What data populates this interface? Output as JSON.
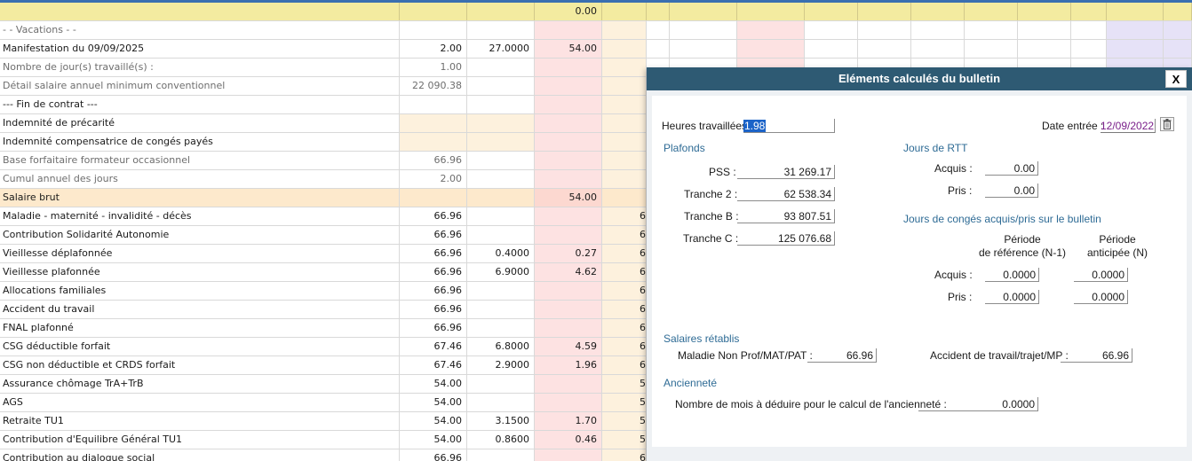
{
  "grid": {
    "header_value": "0.00",
    "rows": [
      {
        "label": "- - Vacations - -",
        "style": "grey"
      },
      {
        "label": "Manifestation du 09/09/2025",
        "base": "2.00",
        "taux": "27.0000",
        "gain": "54.00"
      },
      {
        "label": "Nombre de jour(s) travaillé(s) :",
        "base": "1.00",
        "style": "grey"
      },
      {
        "label": "Détail salaire annuel minimum conventionnel",
        "base": "22 090.38",
        "style": "grey"
      },
      {
        "label": "--- Fin de contrat ---"
      },
      {
        "label": "Indemnité de précarité",
        "tint": "brut"
      },
      {
        "label": "Indemnité compensatrice de congés payés",
        "tint": "brut"
      },
      {
        "label": "Base forfaitaire formateur occasionnel",
        "base": "66.96",
        "style": "grey"
      },
      {
        "label": "Cumul annuel des jours",
        "base": "2.00",
        "style": "grey"
      },
      {
        "label": "Salaire brut",
        "gain": "54.00",
        "style": "brut"
      },
      {
        "label": "Maladie - maternité - invalidité - décès",
        "base": "66.96",
        "trunc": "6"
      },
      {
        "label": "Contribution Solidarité Autonomie",
        "base": "66.96",
        "trunc": "6"
      },
      {
        "label": "Vieillesse déplafonnée",
        "base": "66.96",
        "taux": "0.4000",
        "gain": "0.27",
        "trunc": "6"
      },
      {
        "label": "Vieillesse plafonnée",
        "base": "66.96",
        "taux": "6.9000",
        "gain": "4.62",
        "trunc": "6"
      },
      {
        "label": "Allocations familiales",
        "base": "66.96",
        "trunc": "6"
      },
      {
        "label": "Accident du travail",
        "base": "66.96",
        "trunc": "6"
      },
      {
        "label": "FNAL plafonné",
        "base": "66.96",
        "trunc": "6"
      },
      {
        "label": "CSG déductible forfait",
        "base": "67.46",
        "taux": "6.8000",
        "gain": "4.59",
        "trunc": "6"
      },
      {
        "label": "CSG non déductible et CRDS forfait",
        "base": "67.46",
        "taux": "2.9000",
        "gain": "1.96",
        "trunc": "6"
      },
      {
        "label": "Assurance chômage TrA+TrB",
        "base": "54.00",
        "trunc": "5"
      },
      {
        "label": "AGS",
        "base": "54.00",
        "trunc": "5"
      },
      {
        "label": "Retraite TU1",
        "base": "54.00",
        "taux": "3.1500",
        "gain": "1.70",
        "trunc": "5"
      },
      {
        "label": "Contribution d'Equilibre Général TU1",
        "base": "54.00",
        "taux": "0.8600",
        "gain": "0.46",
        "trunc": "5"
      },
      {
        "label": "Contribution au dialogue social",
        "base": "66.96",
        "trunc": "6"
      }
    ]
  },
  "dialog": {
    "title": "Eléments calculés du bulletin",
    "close_label": "X",
    "heures_label": "Heures travaillées :",
    "heures_value": "1.98",
    "date_entree_label": "Date entrée :",
    "date_entree_value": "12/09/2022",
    "plafonds_title": "Plafonds",
    "pss_label": "PSS :",
    "pss_value": "31 269.17",
    "tranche2_label": "Tranche 2 :",
    "tranche2_value": "62 538.34",
    "trancheB_label": "Tranche B :",
    "trancheB_value": "93 807.51",
    "trancheC_label": "Tranche C :",
    "trancheC_value": "125 076.68",
    "rtt_title": "Jours de RTT",
    "rtt_acquis_label": "Acquis :",
    "rtt_acquis_value": "0.00",
    "rtt_pris_label": "Pris :",
    "rtt_pris_value": "0.00",
    "conges_title": "Jours de congés acquis/pris sur le bulletin",
    "col_ref_line1": "Période",
    "col_ref_line2": "de référence (N-1)",
    "col_ant_line1": "Période",
    "col_ant_line2": "anticipée (N)",
    "conges_acquis_label": "Acquis :",
    "conges_acquis_ref": "0.0000",
    "conges_acquis_ant": "0.0000",
    "conges_pris_label": "Pris :",
    "conges_pris_ref": "0.0000",
    "conges_pris_ant": "0.0000",
    "salaires_title": "Salaires rétablis",
    "maladie_label": "Maladie Non Prof/MAT/PAT :",
    "maladie_value": "66.96",
    "accident_label": "Accident de travail/trajet/MP :",
    "accident_value": "66.96",
    "anciennete_title": "Ancienneté",
    "anciennete_label": "Nombre de mois à déduire pour le calcul de l'ancienneté :",
    "anciennete_value": "0.0000"
  },
  "colors": {
    "title_bar": "#2e5a73",
    "section_text": "#2e6b95",
    "selection": "#1b63c8",
    "date_text": "#7a1f8a",
    "header_row": "#f3eba0",
    "gain_column": "#fde2e2",
    "brut_row": "#fde9cc"
  }
}
